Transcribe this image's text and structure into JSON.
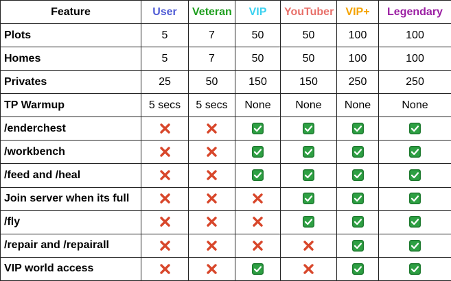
{
  "header": {
    "feature_label": "Feature",
    "tiers": [
      {
        "label": "User",
        "color": "#4f5bd5"
      },
      {
        "label": "Veteran",
        "color": "#1e9e1e"
      },
      {
        "label": "VIP",
        "color": "#3ad1f0"
      },
      {
        "label": "YouTuber",
        "color": "#e8706a"
      },
      {
        "label": "VIP+",
        "color": "#f4a300"
      },
      {
        "label": "Legendary",
        "color": "#9b1fa3"
      }
    ]
  },
  "rows": [
    {
      "feature": "Plots",
      "values": [
        "5",
        "7",
        "50",
        "50",
        "100",
        "100"
      ]
    },
    {
      "feature": "Homes",
      "values": [
        "5",
        "7",
        "50",
        "50",
        "100",
        "100"
      ]
    },
    {
      "feature": "Privates",
      "values": [
        "25",
        "50",
        "150",
        "150",
        "250",
        "250"
      ]
    },
    {
      "feature": "TP Warmup",
      "values": [
        "5 secs",
        "5 secs",
        "None",
        "None",
        "None",
        "None"
      ]
    },
    {
      "feature": "/enderchest",
      "values": [
        "cross-icon",
        "cross-icon",
        "check-icon",
        "check-icon",
        "check-icon",
        "check-icon"
      ]
    },
    {
      "feature": "/workbench",
      "values": [
        "cross-icon",
        "cross-icon",
        "check-icon",
        "check-icon",
        "check-icon",
        "check-icon"
      ]
    },
    {
      "feature": "/feed and /heal",
      "values": [
        "cross-icon",
        "cross-icon",
        "check-icon",
        "check-icon",
        "check-icon",
        "check-icon"
      ]
    },
    {
      "feature": "Join server when its full",
      "values": [
        "cross-icon",
        "cross-icon",
        "cross-icon",
        "check-icon",
        "check-icon",
        "check-icon"
      ]
    },
    {
      "feature": "/fly",
      "values": [
        "cross-icon",
        "cross-icon",
        "cross-icon",
        "check-icon",
        "check-icon",
        "check-icon"
      ]
    },
    {
      "feature": "/repair and /repairall",
      "values": [
        "cross-icon",
        "cross-icon",
        "cross-icon",
        "cross-icon",
        "check-icon",
        "check-icon"
      ]
    },
    {
      "feature": "VIP world access",
      "values": [
        "cross-icon",
        "cross-icon",
        "check-icon",
        "cross-icon",
        "check-icon",
        "check-icon"
      ]
    }
  ],
  "icon_colors": {
    "check_bg": "#2ea043",
    "check_border": "#1f7a30",
    "check_mark": "#ffffff",
    "cross": "#d8472b"
  }
}
